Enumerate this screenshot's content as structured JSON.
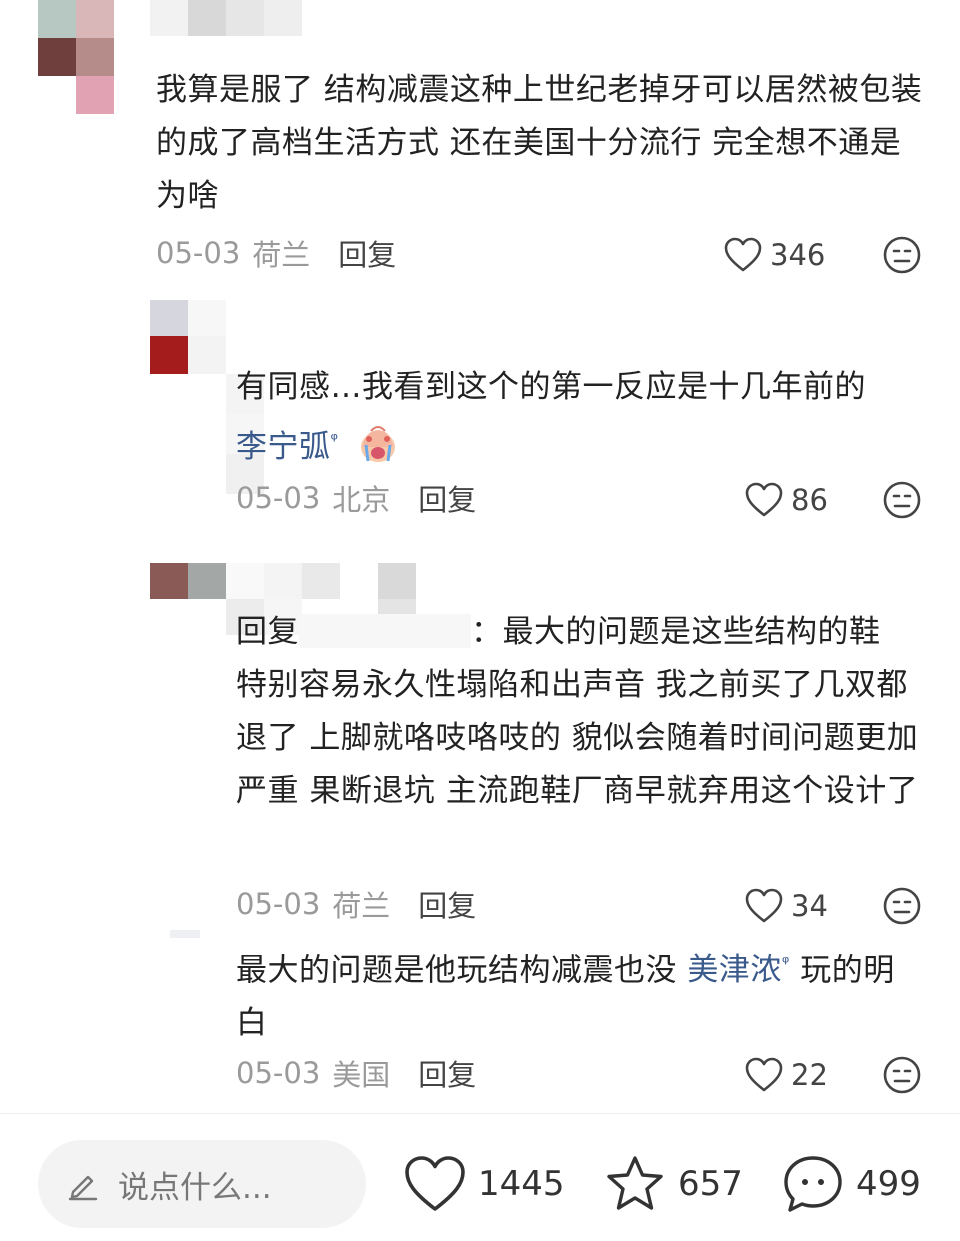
{
  "comments": [
    {
      "text": "我算是服了 结构减震这种上世纪老掉牙可以居然被包装的成了高档生活方式 还在美国十分流行 完全想不通是为啥",
      "date": "05-03",
      "location": "荷兰",
      "reply_label": "回复",
      "likes": "346"
    },
    {
      "text": "有同感…我看到这个的第一反应是十几年前的",
      "mention": "李宁弧",
      "emoji": "crying-face",
      "date": "05-03",
      "location": "北京",
      "reply_label": "回复",
      "likes": "86"
    },
    {
      "reply_prefix": "回复",
      "text_after_name": "：最大的问题是这些结构的鞋",
      "text": "特别容易永久性塌陷和出声音 我之前买了几双都退了 上脚就咯吱咯吱的 貌似会随着时间问题更加严重 果断退坑 主流跑鞋厂商早就弃用这个设计了",
      "date": "05-03",
      "location": "荷兰",
      "reply_label": "回复",
      "likes": "34"
    },
    {
      "text_before": "最大的问题是他玩结构减震也没",
      "mention": "美津浓",
      "text_after": "玩的明白",
      "date": "05-03",
      "location": "美国",
      "reply_label": "回复",
      "likes": "22"
    }
  ],
  "search_mark": "ᵠ",
  "bottom": {
    "input_placeholder": "说点什么...",
    "likes": "1445",
    "favorites": "657",
    "comments": "499"
  },
  "colors": {
    "mention": "#3a5a8c",
    "meta": "#9a9a9a",
    "icon": "#444444"
  },
  "icons": [
    "heart-icon",
    "dislike-face-icon",
    "pencil-icon",
    "star-icon",
    "chat-bubble-icon"
  ]
}
